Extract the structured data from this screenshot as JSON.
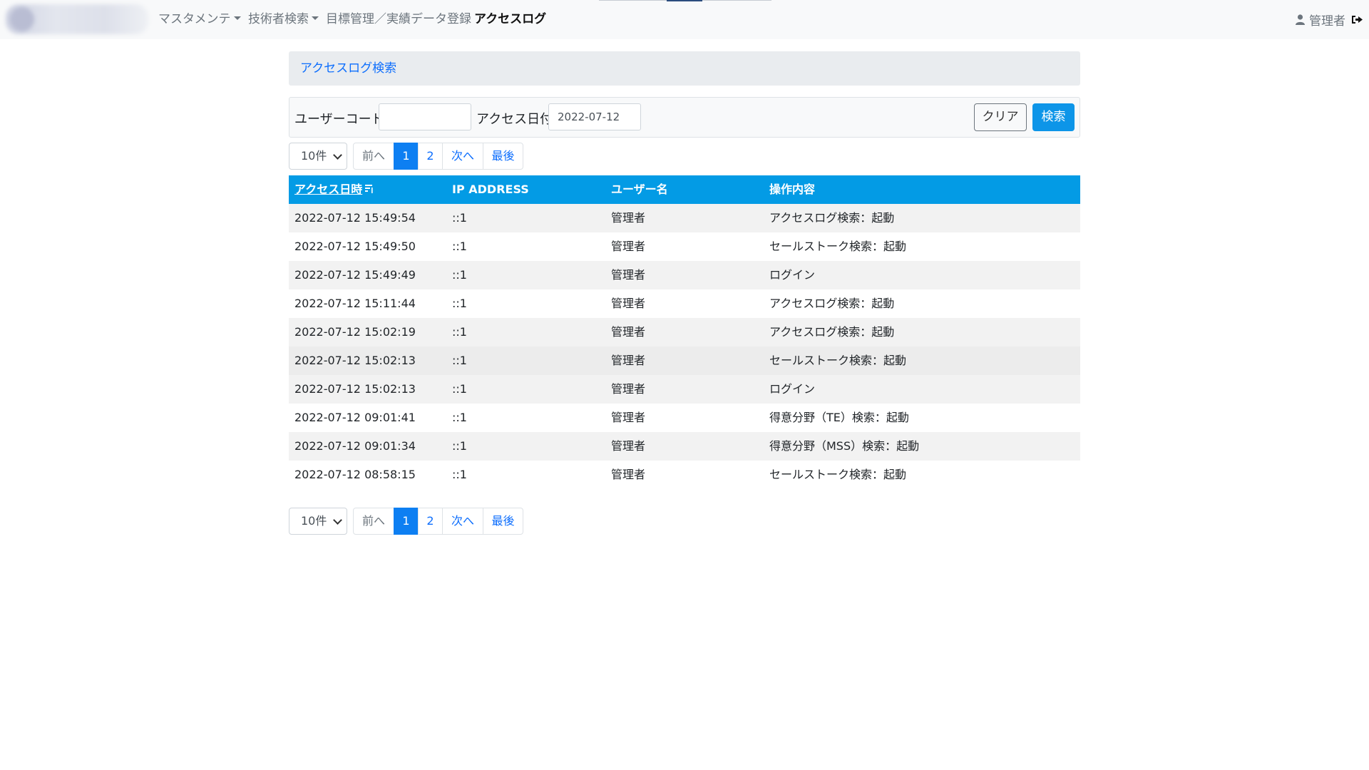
{
  "nav": {
    "items": [
      {
        "label": "マスタメンテ",
        "dropdown": true,
        "active": false
      },
      {
        "label": "技術者検索",
        "dropdown": true,
        "active": false
      },
      {
        "label": "目標管理／実績データ登録",
        "dropdown": false,
        "active": false
      },
      {
        "label": "アクセスログ",
        "dropdown": false,
        "active": true
      }
    ],
    "user_label": "管理者"
  },
  "panel": {
    "title": "アクセスログ検索"
  },
  "search": {
    "user_code_label": "ユーザーコード",
    "user_code_value": "",
    "access_date_label": "アクセス日付",
    "access_date_value": "2022-07-12",
    "clear_label": "クリア",
    "search_label": "検索"
  },
  "pager": {
    "per_page": "10件",
    "prev_label": "前へ",
    "pages": [
      "1",
      "2"
    ],
    "current_page": "1",
    "next_label": "次へ",
    "last_label": "最後"
  },
  "table": {
    "columns": [
      "アクセス日時",
      "IP ADDRESS",
      "ユーザー名",
      "操作内容"
    ],
    "rows": [
      [
        "2022-07-12 15:49:54",
        "::1",
        "管理者",
        "アクセスログ検索：起動"
      ],
      [
        "2022-07-12 15:49:50",
        "::1",
        "管理者",
        "セールストーク検索：起動"
      ],
      [
        "2022-07-12 15:49:49",
        "::1",
        "管理者",
        "ログイン"
      ],
      [
        "2022-07-12 15:11:44",
        "::1",
        "管理者",
        "アクセスログ検索：起動"
      ],
      [
        "2022-07-12 15:02:19",
        "::1",
        "管理者",
        "アクセスログ検索：起動"
      ],
      [
        "2022-07-12 15:02:13",
        "::1",
        "管理者",
        "セールストーク検索：起動"
      ],
      [
        "2022-07-12 15:02:13",
        "::1",
        "管理者",
        "ログイン"
      ],
      [
        "2022-07-12 09:01:41",
        "::1",
        "管理者",
        "得意分野（TE）検索：起動"
      ],
      [
        "2022-07-12 09:01:34",
        "::1",
        "管理者",
        "得意分野（MSS）検索：起動"
      ],
      [
        "2022-07-12 08:58:15",
        "::1",
        "管理者",
        "セールストーク検索：起動"
      ]
    ]
  },
  "colors": {
    "header_bg": "#039be5",
    "primary": "#0d6efd",
    "active_page": "#0d7ff2",
    "search_button": "#0d95e8"
  },
  "icons": {
    "user": "user-icon",
    "logout": "logout-icon",
    "sort": "sort-icon"
  }
}
